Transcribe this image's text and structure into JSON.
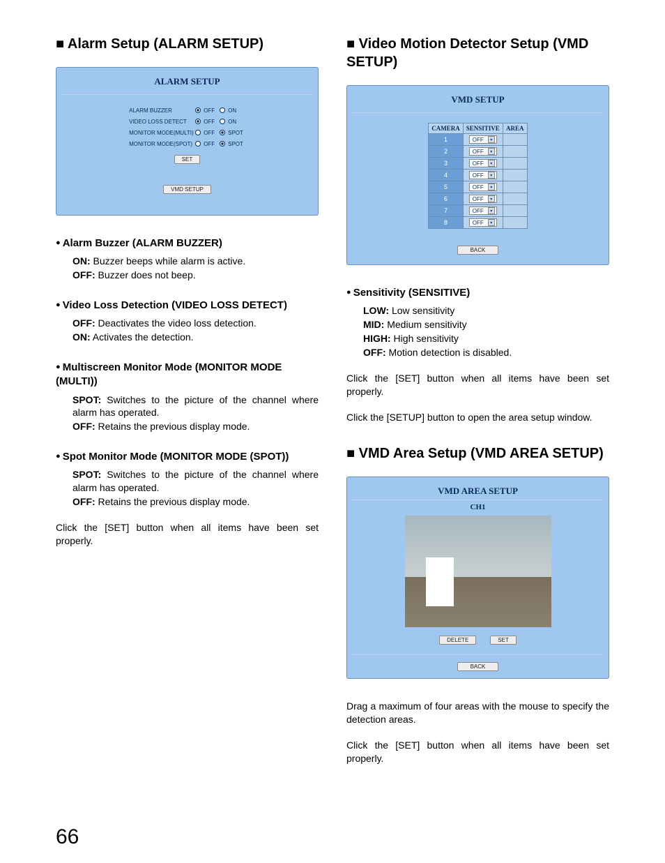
{
  "pageNumber": "66",
  "left": {
    "heading": "■ Alarm Setup (ALARM SETUP)",
    "panel": {
      "title": "ALARM SETUP",
      "rows": [
        {
          "label": "ALARM BUZZER",
          "opts": [
            "OFF",
            "ON"
          ],
          "sel": 0
        },
        {
          "label": "VIDEO LOSS DETECT",
          "opts": [
            "OFF",
            "ON"
          ],
          "sel": 0
        },
        {
          "label": "MONITOR MODE(MULTI)",
          "opts": [
            "OFF",
            "SPOT"
          ],
          "sel": 1
        },
        {
          "label": "MONITOR MODE(SPOT)",
          "opts": [
            "OFF",
            "SPOT"
          ],
          "sel": 1
        }
      ],
      "setBtn": "SET",
      "vmdBtn": "VMD SETUP"
    },
    "sections": [
      {
        "title": "Alarm Buzzer (ALARM BUZZER)",
        "defs": [
          {
            "k": "ON:",
            "v": " Buzzer beeps while alarm is active."
          },
          {
            "k": "OFF:",
            "v": " Buzzer does not beep."
          }
        ]
      },
      {
        "title": "Video Loss Detection (VIDEO LOSS DETECT)",
        "defs": [
          {
            "k": "OFF:",
            "v": " Deactivates the video loss detection."
          },
          {
            "k": "ON:",
            "v": " Activates the detection."
          }
        ]
      },
      {
        "title": "Multiscreen Monitor Mode (MONITOR MODE (MULTI))",
        "defs": [
          {
            "k": "SPOT:",
            "v": " Switches to the picture of the channel where alarm has operated.",
            "just": true
          },
          {
            "k": "OFF:",
            "v": " Retains the previous display mode."
          }
        ]
      },
      {
        "title": "Spot Monitor Mode (MONITOR MODE (SPOT))",
        "defs": [
          {
            "k": "SPOT:",
            "v": " Switches to the picture of the channel where alarm has operated.",
            "just": true
          },
          {
            "k": "OFF:",
            "v": " Retains the previous display mode."
          }
        ]
      }
    ],
    "footer": "Click the [SET] button when all items have been set properly."
  },
  "right": {
    "heading1": "■ Video Motion Detector Setup (VMD SETUP)",
    "vmdPanel": {
      "title": "VMD SETUP",
      "cols": [
        "CAMERA",
        "SENSITIVE",
        "AREA"
      ],
      "rows": [
        {
          "cam": "1",
          "sens": "OFF"
        },
        {
          "cam": "2",
          "sens": "OFF"
        },
        {
          "cam": "3",
          "sens": "OFF"
        },
        {
          "cam": "4",
          "sens": "OFF"
        },
        {
          "cam": "5",
          "sens": "OFF"
        },
        {
          "cam": "6",
          "sens": "OFF"
        },
        {
          "cam": "7",
          "sens": "OFF"
        },
        {
          "cam": "8",
          "sens": "OFF"
        }
      ],
      "back": "BACK"
    },
    "sens": {
      "title": "Sensitivity (SENSITIVE)",
      "defs": [
        {
          "k": "LOW:",
          "v": " Low sensitivity"
        },
        {
          "k": "MID:",
          "v": " Medium sensitivity"
        },
        {
          "k": "HIGH:",
          "v": " High sensitivity"
        },
        {
          "k": "OFF:",
          "v": " Motion detection is disabled."
        }
      ]
    },
    "p1": "Click the [SET] button when all items have been set properly.",
    "p2": "Click the [SETUP] button to open the area setup window.",
    "heading2": "■ VMD Area Setup (VMD AREA SETUP)",
    "areaPanel": {
      "title": "VMD AREA SETUP",
      "sub": "CH1",
      "del": "DELETE",
      "set": "SET",
      "back": "BACK"
    },
    "p3": "Drag a maximum of four areas with the mouse to specify the detection areas.",
    "p4": "Click the [SET] button when all items have been set properly."
  }
}
